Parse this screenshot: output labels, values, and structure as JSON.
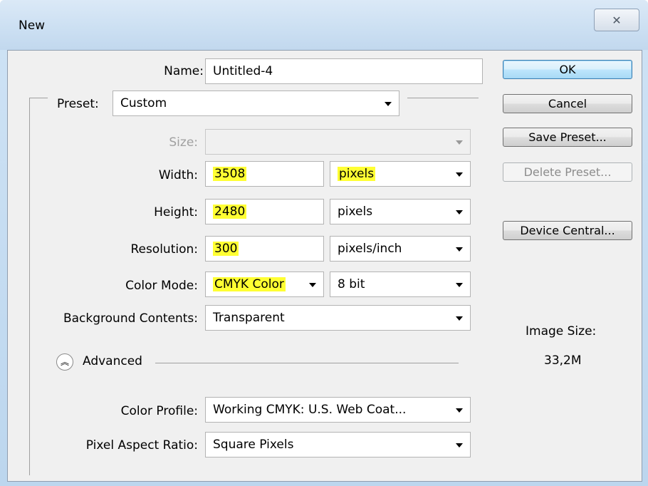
{
  "window": {
    "title": "New",
    "close_glyph": "✕"
  },
  "form": {
    "name_label": "Name:",
    "name_value": "Untitled-4",
    "preset_label": "Preset:",
    "preset_value": "Custom",
    "size_label": "Size:",
    "size_value": "",
    "width_label": "Width:",
    "width_value": "3508",
    "width_unit": "pixels",
    "height_label": "Height:",
    "height_value": "2480",
    "height_unit": "pixels",
    "resolution_label": "Resolution:",
    "resolution_value": "300",
    "resolution_unit": "pixels/inch",
    "color_mode_label": "Color Mode:",
    "color_mode_value": "CMYK Color",
    "bit_depth_value": "8 bit",
    "background_label": "Background Contents:",
    "background_value": "Transparent",
    "advanced_label": "Advanced",
    "advanced_icon": "double-chevron-up-icon",
    "color_profile_label": "Color Profile:",
    "color_profile_value": "Working CMYK:  U.S. Web Coat...",
    "pixel_aspect_label": "Pixel Aspect Ratio:",
    "pixel_aspect_value": "Square Pixels"
  },
  "buttons": {
    "ok": "OK",
    "cancel": "Cancel",
    "save_preset": "Save Preset...",
    "delete_preset": "Delete Preset...",
    "device_central": "Device Central..."
  },
  "image_size": {
    "label": "Image Size:",
    "value": "33,2M"
  },
  "colors": {
    "highlight": "#ffff33",
    "dialog_bg": "#f0f0f0",
    "title_bar": "#cbdff2"
  }
}
